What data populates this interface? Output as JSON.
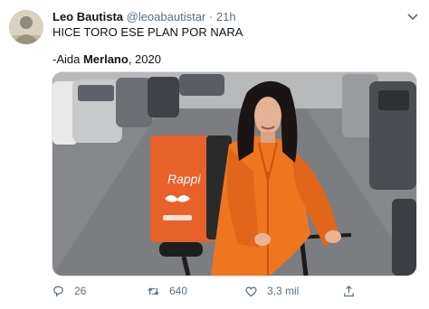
{
  "tweet": {
    "author_name": "Leo Bautista",
    "handle": "@leoabautistar",
    "separator": "·",
    "time": "21h",
    "text_line1": "HICE TORO ESE PLAN POR NARA",
    "attribution_prefix": "-Aida ",
    "attribution_bold": "Merlano",
    "attribution_suffix": ", 2020"
  },
  "media": {
    "bag_brand": "Rappi"
  },
  "actions": {
    "replies": "26",
    "retweets": "640",
    "likes": "3,3 mil"
  },
  "colors": {
    "jacket": "#f0751f",
    "muted": "#5b7083"
  },
  "icons": [
    "chevron-down-icon",
    "reply-icon",
    "retweet-icon",
    "like-icon",
    "share-icon"
  ]
}
